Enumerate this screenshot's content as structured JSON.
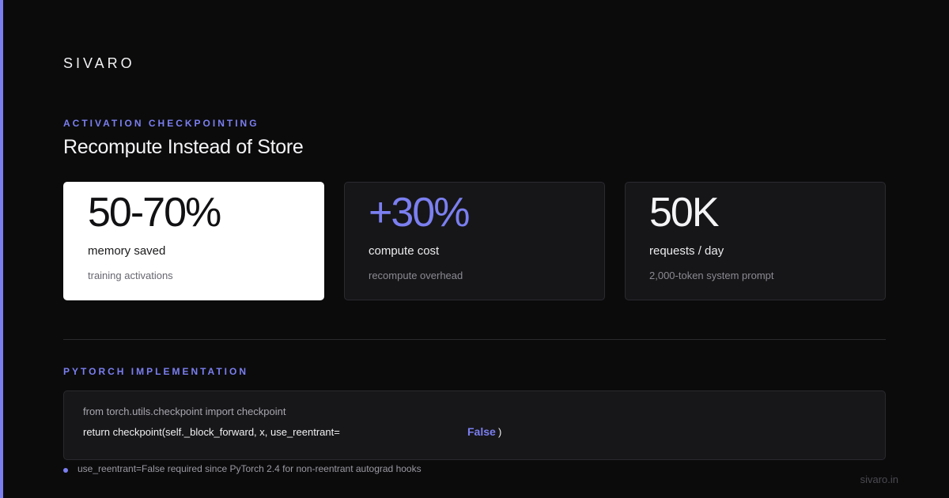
{
  "theme": {
    "accent": "#7b7ff0",
    "background": "#0b0b0c"
  },
  "brand": "SIVARO",
  "section": {
    "eyebrow": "ACTIVATION CHECKPOINTING",
    "title": "Recompute Instead of Store"
  },
  "cards": [
    {
      "value": "50-70%",
      "label": "memory saved",
      "sub": "training activations",
      "style": "light"
    },
    {
      "value": "+30%",
      "label": "compute cost",
      "sub": "recompute overhead",
      "style": "accent"
    },
    {
      "value": "50K",
      "label": "requests / day",
      "sub": "2,000-token system prompt",
      "style": "dark"
    }
  ],
  "code": {
    "eyebrow": "PYTORCH IMPLEMENTATION",
    "line1": "from torch.utils.checkpoint import checkpoint",
    "line2": "return checkpoint(self._block_forward, x, use_reentrant=",
    "keyword": "False",
    "close": ")"
  },
  "note": {
    "text": "use_reentrant=False required since PyTorch 2.4 for non-reentrant autograd hooks"
  },
  "footer": {
    "site": "sivaro.in"
  }
}
